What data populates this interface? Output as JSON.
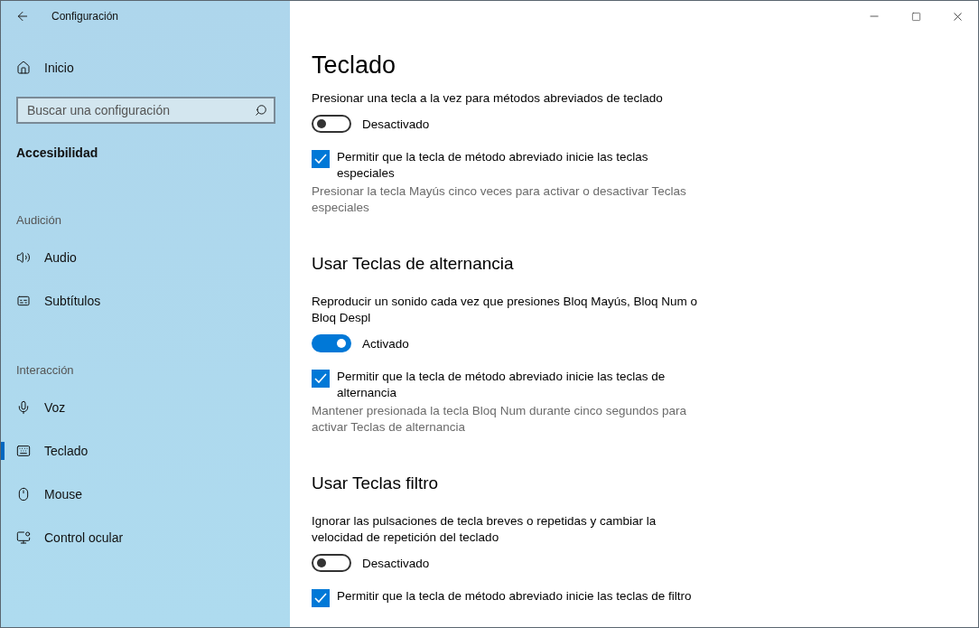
{
  "window": {
    "title": "Configuración"
  },
  "sidebar": {
    "home": "Inicio",
    "search": {
      "placeholder": "Buscar una configuración"
    },
    "category": "Accesibilidad",
    "groups": [
      {
        "title": "Audición",
        "items": [
          {
            "label": "Audio",
            "selected": false
          },
          {
            "label": "Subtítulos",
            "selected": false
          }
        ]
      },
      {
        "title": "Interacción",
        "items": [
          {
            "label": "Voz",
            "selected": false
          },
          {
            "label": "Teclado",
            "selected": true
          },
          {
            "label": "Mouse",
            "selected": false
          },
          {
            "label": "Control ocular",
            "selected": false
          }
        ]
      }
    ]
  },
  "main": {
    "title": "Teclado",
    "sections": [
      {
        "description": "Presionar una tecla a la vez para métodos abreviados de teclado",
        "toggle": {
          "on": false,
          "label": "Desactivado"
        },
        "checkbox": {
          "checked": true,
          "label": "Permitir que la tecla de método abreviado inicie las teclas especiales"
        },
        "hint": "Presionar la tecla Mayús cinco veces para activar o desactivar Teclas especiales"
      },
      {
        "heading": "Usar Teclas de alternancia",
        "description": "Reproducir un sonido cada vez que presiones Bloq Mayús, Bloq Num o Bloq Despl",
        "toggle": {
          "on": true,
          "label": "Activado"
        },
        "checkbox": {
          "checked": true,
          "label": "Permitir que la tecla de método abreviado inicie las teclas de alternancia"
        },
        "hint": "Mantener presionada la tecla Bloq Num durante cinco segundos para activar Teclas de alternancia"
      },
      {
        "heading": "Usar Teclas filtro",
        "description": "Ignorar las pulsaciones de tecla breves o repetidas y cambiar la velocidad de repetición del teclado",
        "toggle": {
          "on": false,
          "label": "Desactivado"
        },
        "checkbox": {
          "checked": true,
          "label": "Permitir que la tecla de método abreviado inicie las teclas de filtro"
        }
      }
    ]
  }
}
